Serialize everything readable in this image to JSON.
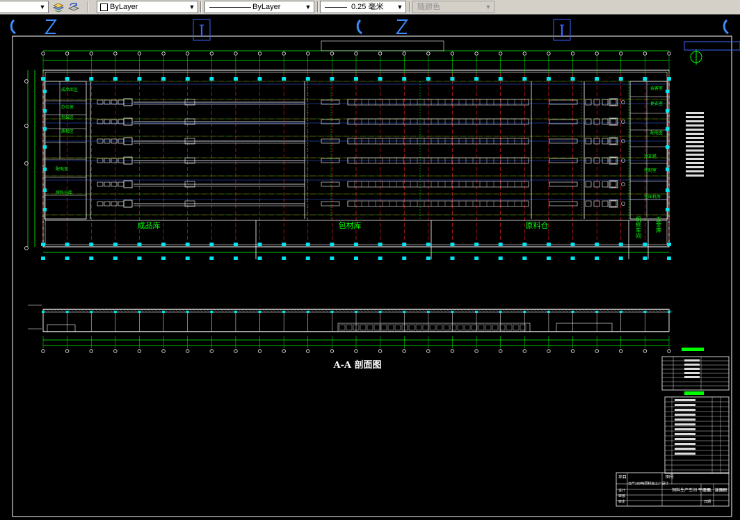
{
  "toolbar": {
    "layer_control_value": "",
    "color_value": "ByLayer",
    "linetype_value": "ByLayer",
    "lineweight_value": "0.25 毫米",
    "plotstyle_value": "随颜色"
  },
  "drawing": {
    "column_marker_left": "I",
    "column_marker_right": "I",
    "area_labels": [
      "成品库",
      "包材库",
      "原料仓"
    ],
    "side_label_right": "五金库",
    "side_label_right2": "机修车间",
    "section_title": "A-A 剖面图",
    "left_room_labels": [
      "成品库区",
      "办公室",
      "包装区",
      "质检区",
      "配电室",
      "原料仓库"
    ],
    "right_room_labels": [
      "会客室",
      "更衣室",
      "配电室",
      "冷却塔",
      "控制室",
      "空压机房"
    ],
    "title_block": {
      "project_label": "项目",
      "project_name": "日产100吨饲料加工厂设计",
      "drawing_no_label": "图号",
      "drawing_name": "饲料生产车间 平面图、剖面图",
      "scale_label": "比例",
      "scale_value": "1:100",
      "rows": [
        "设计",
        "审核",
        "审定"
      ],
      "date_label": "日期"
    }
  },
  "colors": {
    "background": "#000000",
    "line_white": "#ffffff",
    "line_green": "#00ff00",
    "line_red": "#ff2020",
    "marker_cyan": "#00e5ee",
    "line_blue": "#3c64ff",
    "text_yellow": "#e8e8a0"
  }
}
